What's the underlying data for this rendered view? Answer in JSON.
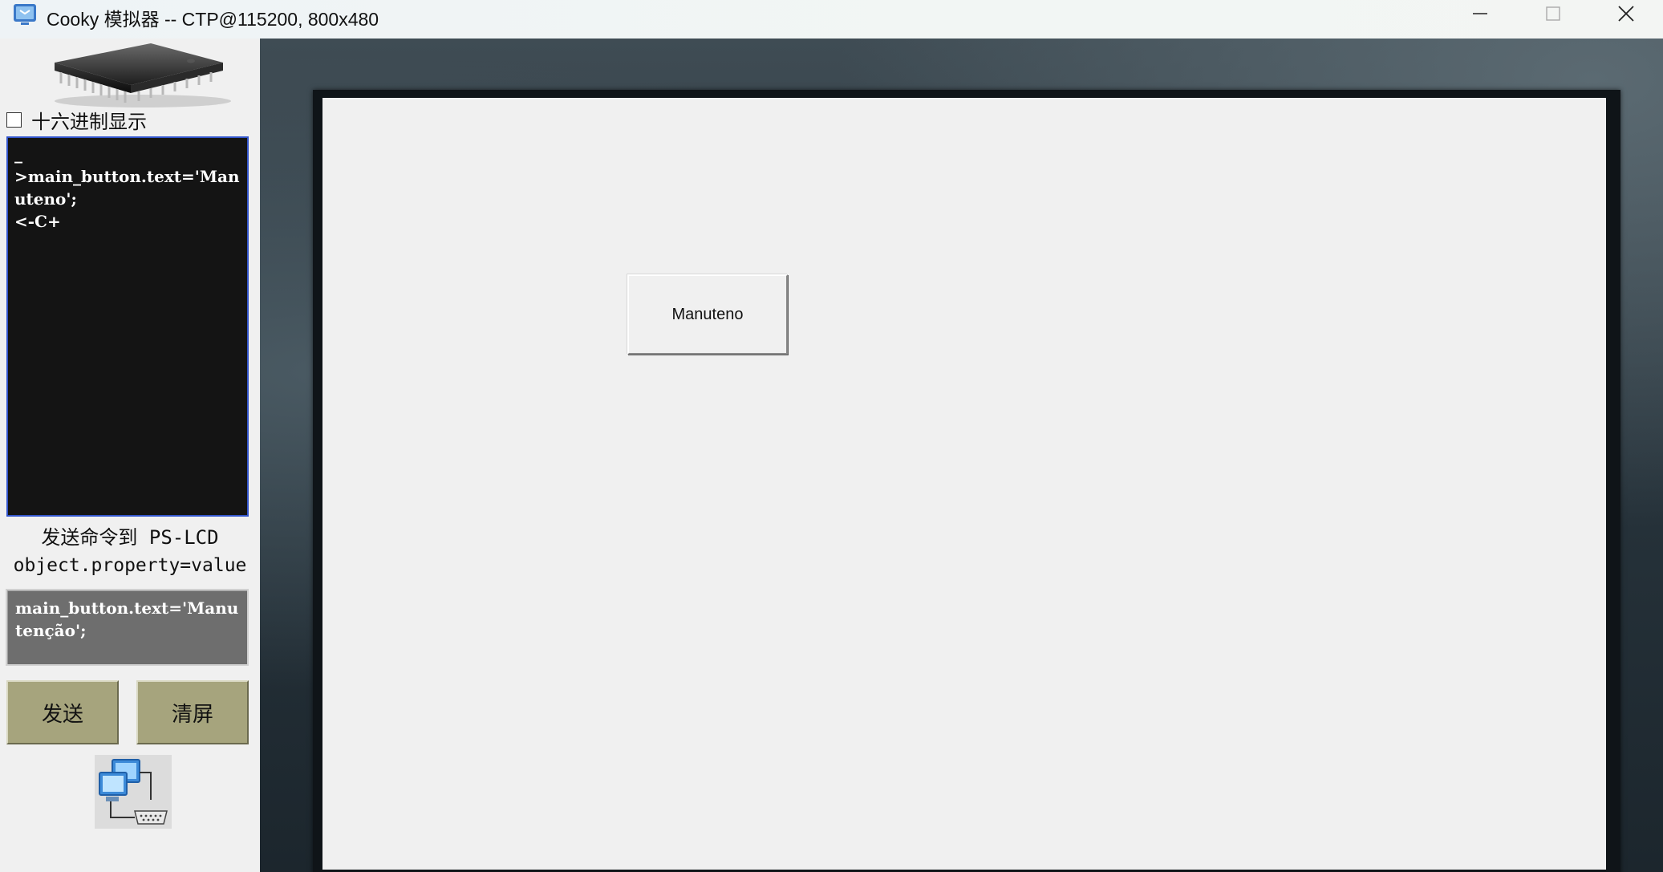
{
  "window": {
    "title": "Cooky 模拟器 -- CTP@115200, 800x480",
    "controls": {
      "minimize_icon": "minimize-icon",
      "maximize_icon": "maximize-icon",
      "close_icon": "close-icon"
    }
  },
  "left_panel": {
    "chip_icon": "microchip-icon",
    "hex_display": {
      "label": "十六进制显示",
      "checked": false
    },
    "console_log": "_\n>main_button.text='Manuteno';\n<-C+",
    "send_caption": "发送命令到 PS-LCD",
    "syntax_hint": "object.property=value",
    "command_input": {
      "value": "main_button.text='Manutenção';"
    },
    "buttons": {
      "send_label": "发送",
      "clear_label": "清屏"
    },
    "connection_icon": "network-serial-connection-icon"
  },
  "simulator": {
    "resolution": "800x480",
    "main_button": {
      "label": "Manuteno"
    }
  },
  "colors": {
    "console_bg": "#141414",
    "console_border": "#3355cc",
    "input_bg": "#6e6e6e",
    "action_button_bg": "#a6a47d",
    "lcd_bg": "#f0f0f0"
  }
}
